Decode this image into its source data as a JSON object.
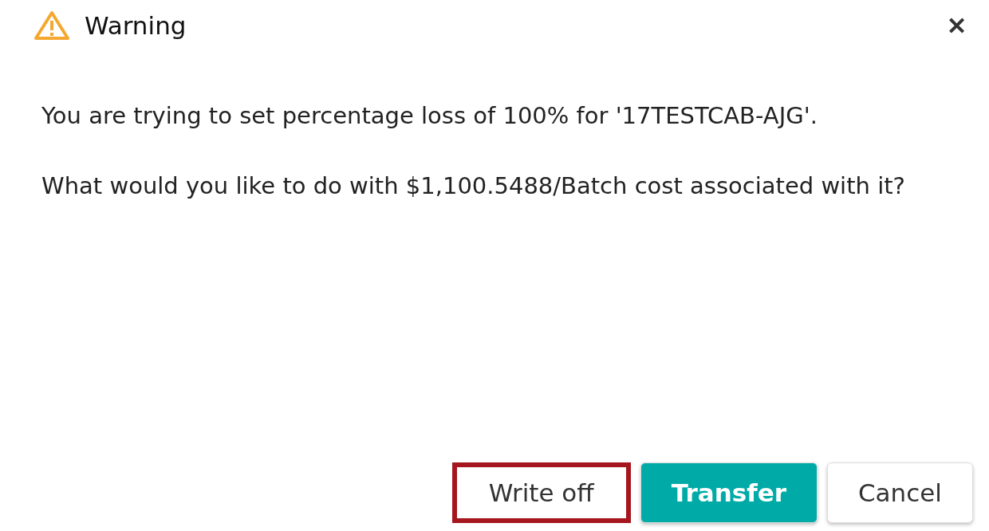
{
  "dialog": {
    "title": "Warning",
    "close": "✕",
    "paragraphs": [
      "You are trying to set percentage loss of 100% for '17TESTCAB-AJG'.",
      "What would you like to do with $1,100.5488/Batch cost associated with it?"
    ],
    "buttons": [
      {
        "label": "Write off",
        "kind": "default",
        "highlighted": true
      },
      {
        "label": "Transfer",
        "kind": "primary",
        "highlighted": false
      },
      {
        "label": "Cancel",
        "kind": "default",
        "highlighted": false
      }
    ]
  }
}
